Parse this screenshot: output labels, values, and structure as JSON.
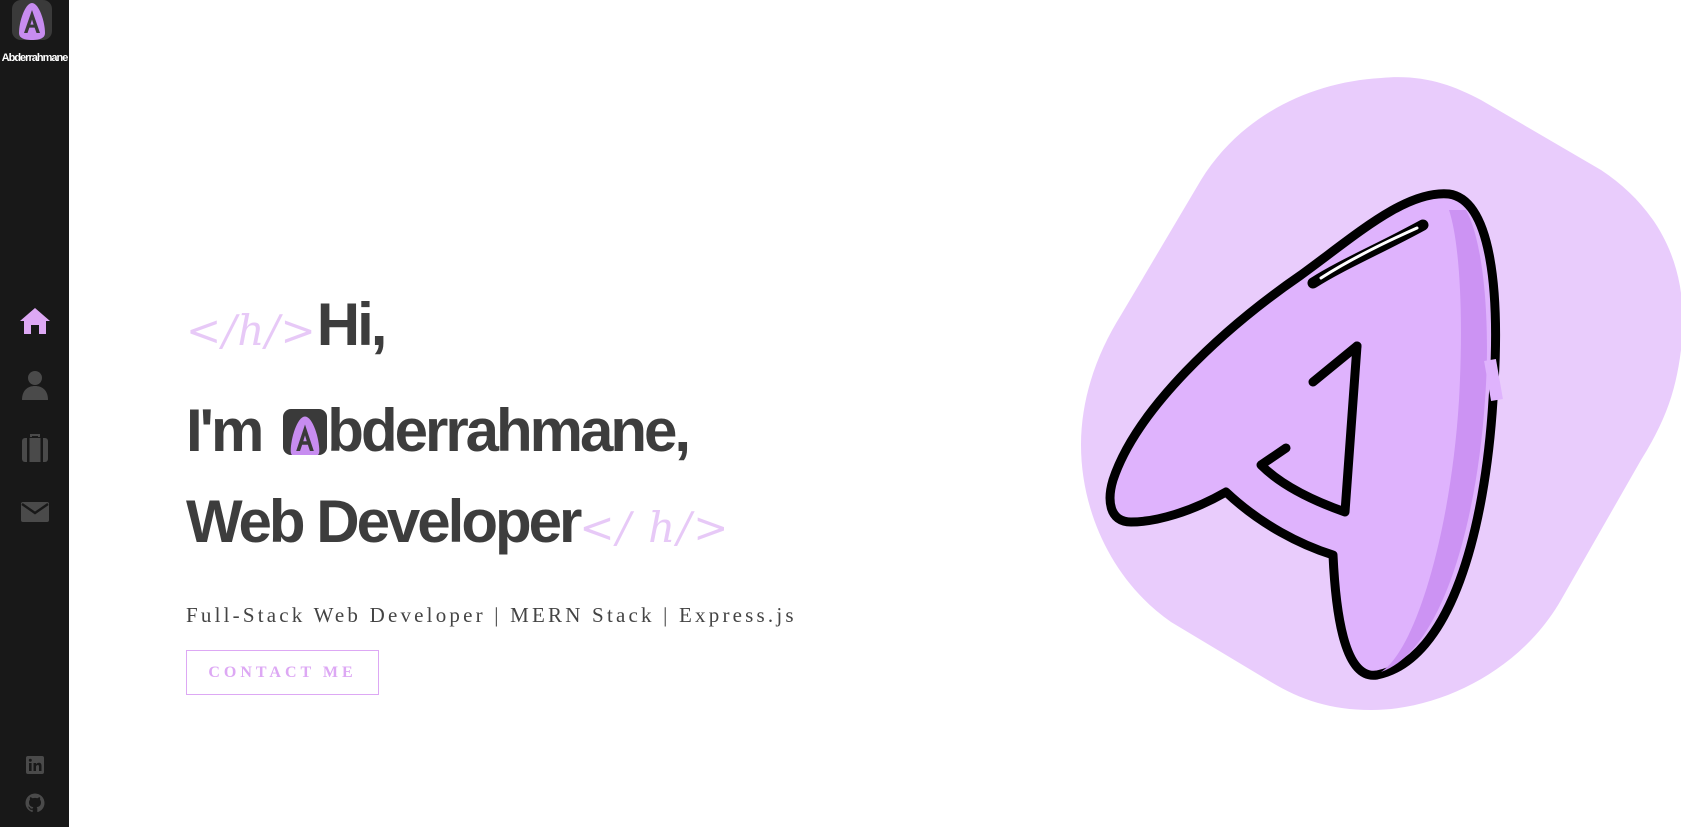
{
  "brand": {
    "name": "Abderrahmane",
    "logo_letter": "A",
    "accent": "#dda8f4",
    "accent_deep": "#c487ee",
    "blob": "#e9ccfc"
  },
  "sidebar": {
    "nav": [
      {
        "name": "home",
        "icon": "home-icon",
        "active": true
      },
      {
        "name": "about",
        "icon": "user-icon",
        "active": false
      },
      {
        "name": "portfolio",
        "icon": "briefcase-icon",
        "active": false
      },
      {
        "name": "contact",
        "icon": "envelope-icon",
        "active": false
      }
    ],
    "social": [
      {
        "name": "linkedin",
        "icon": "linkedin-icon"
      },
      {
        "name": "github",
        "icon": "github-icon"
      }
    ]
  },
  "hero": {
    "open_tag": "</h/>",
    "line1": "Hi,",
    "line2_prefix": "I'm",
    "line2_rest": "bderrahmane,",
    "line3": "Web Developer",
    "close_tag": "</ h/>",
    "subtitle": "Full-Stack Web Developer | MERN Stack | Express.js",
    "cta_label": "CONTACT ME"
  }
}
